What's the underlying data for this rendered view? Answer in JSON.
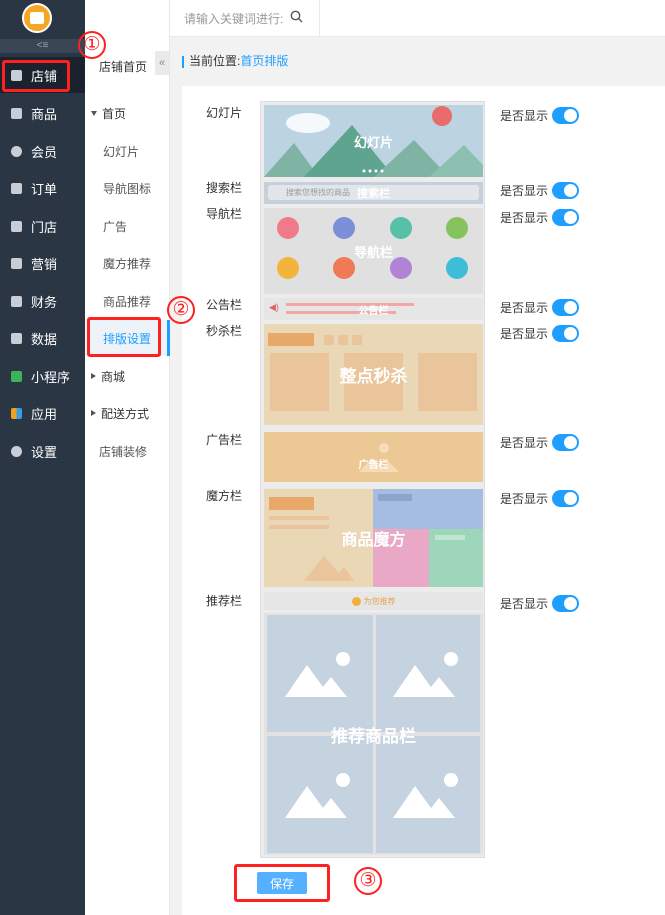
{
  "sidebar": {
    "logo_text": "商城",
    "collapse": "<≡",
    "items": [
      {
        "label": "店铺",
        "icon": "store-icon",
        "active": true
      },
      {
        "label": "商品",
        "icon": "goods-icon"
      },
      {
        "label": "会员",
        "icon": "user-icon"
      },
      {
        "label": "订单",
        "icon": "order-icon"
      },
      {
        "label": "门店",
        "icon": "shop-icon"
      },
      {
        "label": "营销",
        "icon": "gift-icon"
      },
      {
        "label": "财务",
        "icon": "money-bag-icon"
      },
      {
        "label": "数据",
        "icon": "chart-icon"
      },
      {
        "label": "小程序",
        "icon": "miniapp-icon"
      },
      {
        "label": "应用",
        "icon": "apps-icon"
      },
      {
        "label": "设置",
        "icon": "gear-icon"
      }
    ]
  },
  "topbar": {
    "search_placeholder": "请输入关键词进行:"
  },
  "subnav": {
    "title": "店铺首页",
    "collapse_glyph": "«",
    "items": [
      {
        "label": "首页",
        "level": 1,
        "expanded": true
      },
      {
        "label": "幻灯片",
        "level": 2
      },
      {
        "label": "导航图标",
        "level": 2
      },
      {
        "label": "广告",
        "level": 2
      },
      {
        "label": "魔方推荐",
        "level": 2
      },
      {
        "label": "商品推荐",
        "level": 2
      },
      {
        "label": "排版设置",
        "level": 2,
        "active": true
      },
      {
        "label": "商城",
        "level": 1
      },
      {
        "label": "配送方式",
        "level": 1
      },
      {
        "label": "店铺装修",
        "level": 0
      }
    ]
  },
  "breadcrumb": {
    "prefix": "当前位置:",
    "current": "首页排版"
  },
  "layout_rows": [
    {
      "label": "幻灯片",
      "show_label": "是否显示",
      "enabled": true
    },
    {
      "label": "搜索栏",
      "show_label": "是否显示",
      "enabled": true
    },
    {
      "label": "导航栏",
      "show_label": "是否显示",
      "enabled": true
    },
    {
      "label": "公告栏",
      "show_label": "是否显示",
      "enabled": true
    },
    {
      "label": "秒杀栏",
      "show_label": "是否显示",
      "enabled": true
    },
    {
      "label": "广告栏",
      "show_label": "是否显示",
      "enabled": true
    },
    {
      "label": "魔方栏",
      "show_label": "是否显示",
      "enabled": true
    },
    {
      "label": "推荐栏",
      "show_label": "是否显示",
      "enabled": true
    }
  ],
  "preview": {
    "slide": "幻灯片",
    "search_placeholder": "搜索您想找的商品",
    "search": "搜索栏",
    "nav": "导航栏",
    "notice": "公告栏",
    "seckill": "整点秒杀",
    "ad": "广告栏",
    "cube": "商品魔方",
    "recommend_header": "为您推荐",
    "recommend": "推荐商品栏"
  },
  "save_button": "保存",
  "annotations": [
    "①",
    "②",
    "③"
  ]
}
